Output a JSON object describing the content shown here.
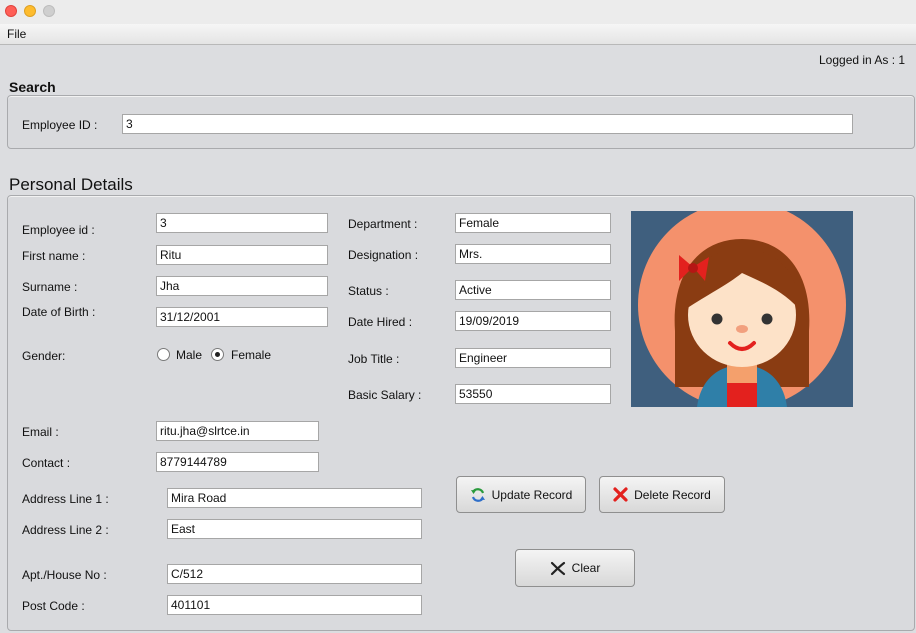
{
  "menu": {
    "file": "File"
  },
  "status": {
    "logged_in": "Logged in As :  1"
  },
  "search": {
    "title": "Search",
    "employee_id_label": "Employee ID :",
    "employee_id_value": "3"
  },
  "personal": {
    "title": "Personal Details",
    "labels": {
      "employee_id": "Employee id :",
      "first_name": "First name :",
      "surname": "Surname :",
      "dob": "Date of Birth :",
      "gender": "Gender:",
      "department": "Department :",
      "designation": "Designation :",
      "status": "Status :",
      "date_hired": "Date Hired :",
      "job_title": "Job Title :",
      "basic_salary": "Basic Salary :",
      "email": "Email :",
      "contact": "Contact :",
      "address1": "Address Line 1 :",
      "address2": "Address Line 2 :",
      "apt": "Apt./House No :",
      "post_code": "Post Code :"
    },
    "values": {
      "employee_id": "3",
      "first_name": "Ritu",
      "surname": "Jha",
      "dob": "31/12/2001",
      "department": "Female",
      "designation": "Mrs.",
      "status": "Active",
      "date_hired": "19/09/2019",
      "job_title": "Engineer",
      "basic_salary": "53550",
      "email": "ritu.jha@slrtce.in",
      "contact": "8779144789",
      "address1": "Mira Road",
      "address2": "East",
      "apt": "C/512",
      "post_code": "401101"
    },
    "gender_options": {
      "male": "Male",
      "female": "Female",
      "selected": "Female"
    }
  },
  "buttons": {
    "update": "Update Record",
    "delete": "Delete Record",
    "clear": "Clear"
  },
  "colors": {
    "window_bg": "#dcdde0",
    "avatar_bg": "#3f5f7e",
    "avatar_circle": "#f4916c",
    "hair": "#8a3c12",
    "bow": "#e3211e",
    "close_dot": "#ff5f57",
    "min_dot": "#febc2e",
    "max_dot": "#cfcfcf"
  },
  "icons": {
    "update": "refresh-icon",
    "delete": "red-x-icon",
    "clear": "x-mark-icon",
    "avatar": "user-avatar-image"
  }
}
